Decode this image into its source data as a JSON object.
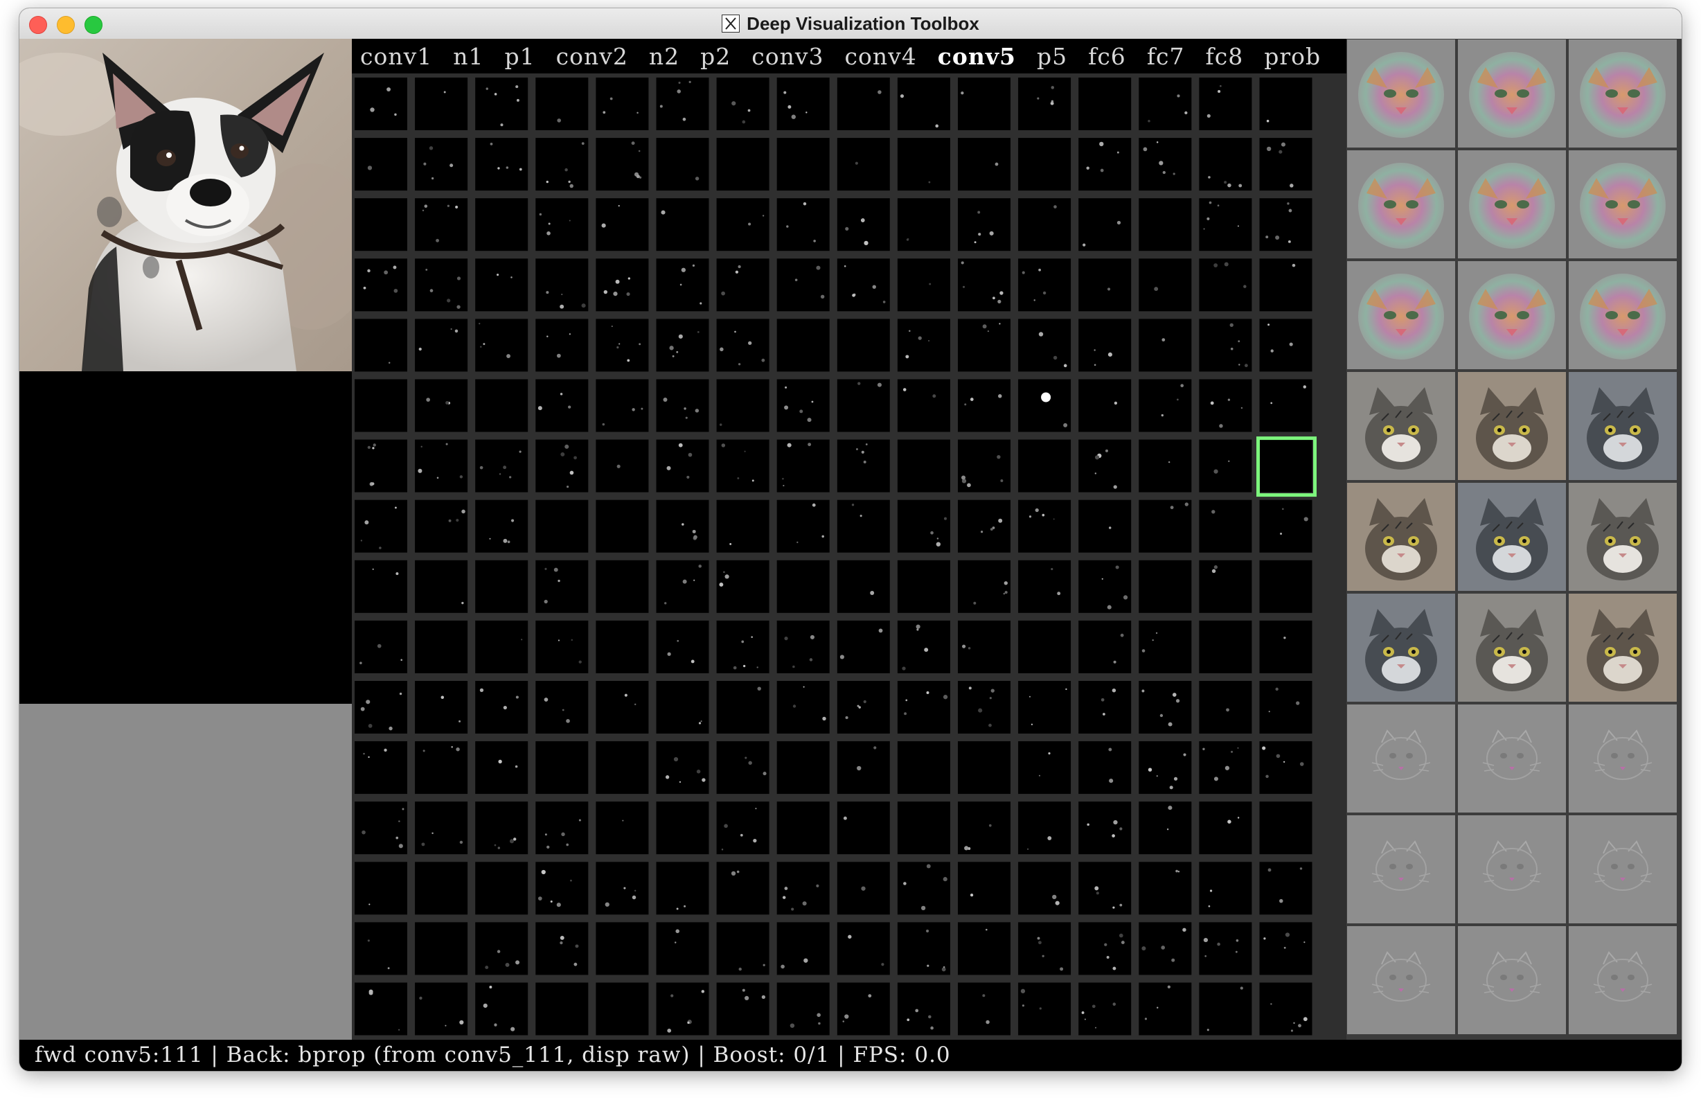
{
  "window": {
    "title": "Deep Visualization Toolbox",
    "app_icon": "x11-icon"
  },
  "input_panel": {
    "image": "french-bulldog-photo"
  },
  "layers": {
    "items": [
      "conv1",
      "n1",
      "p1",
      "conv2",
      "n2",
      "p2",
      "conv3",
      "conv4",
      "conv5",
      "p5",
      "fc6",
      "fc7",
      "fc8",
      "prob"
    ],
    "active": "conv5"
  },
  "unit_grid": {
    "rows": 16,
    "cols": 16,
    "selected_unit": 111,
    "selection_color": "#7df57d"
  },
  "right_panel": {
    "rows": [
      {
        "kind": "optimized-image",
        "palette": "colorful"
      },
      {
        "kind": "optimized-image",
        "palette": "colorful"
      },
      {
        "kind": "optimized-image",
        "palette": "colorful"
      },
      {
        "kind": "top-image",
        "palette": "cat-photo"
      },
      {
        "kind": "top-image",
        "palette": "cat-photo"
      },
      {
        "kind": "top-image",
        "palette": "cat-photo"
      },
      {
        "kind": "deconv-image",
        "palette": "gray"
      },
      {
        "kind": "deconv-image",
        "palette": "gray"
      },
      {
        "kind": "deconv-image",
        "palette": "gray"
      }
    ]
  },
  "status": {
    "text": "fwd conv5:111 | Back: bprop (from conv5_111, disp raw) | Boost: 0/1 | FPS: 0.0"
  },
  "colors": {
    "close": "#fe5f57",
    "minimize": "#febc2e",
    "maximize": "#28c840"
  }
}
